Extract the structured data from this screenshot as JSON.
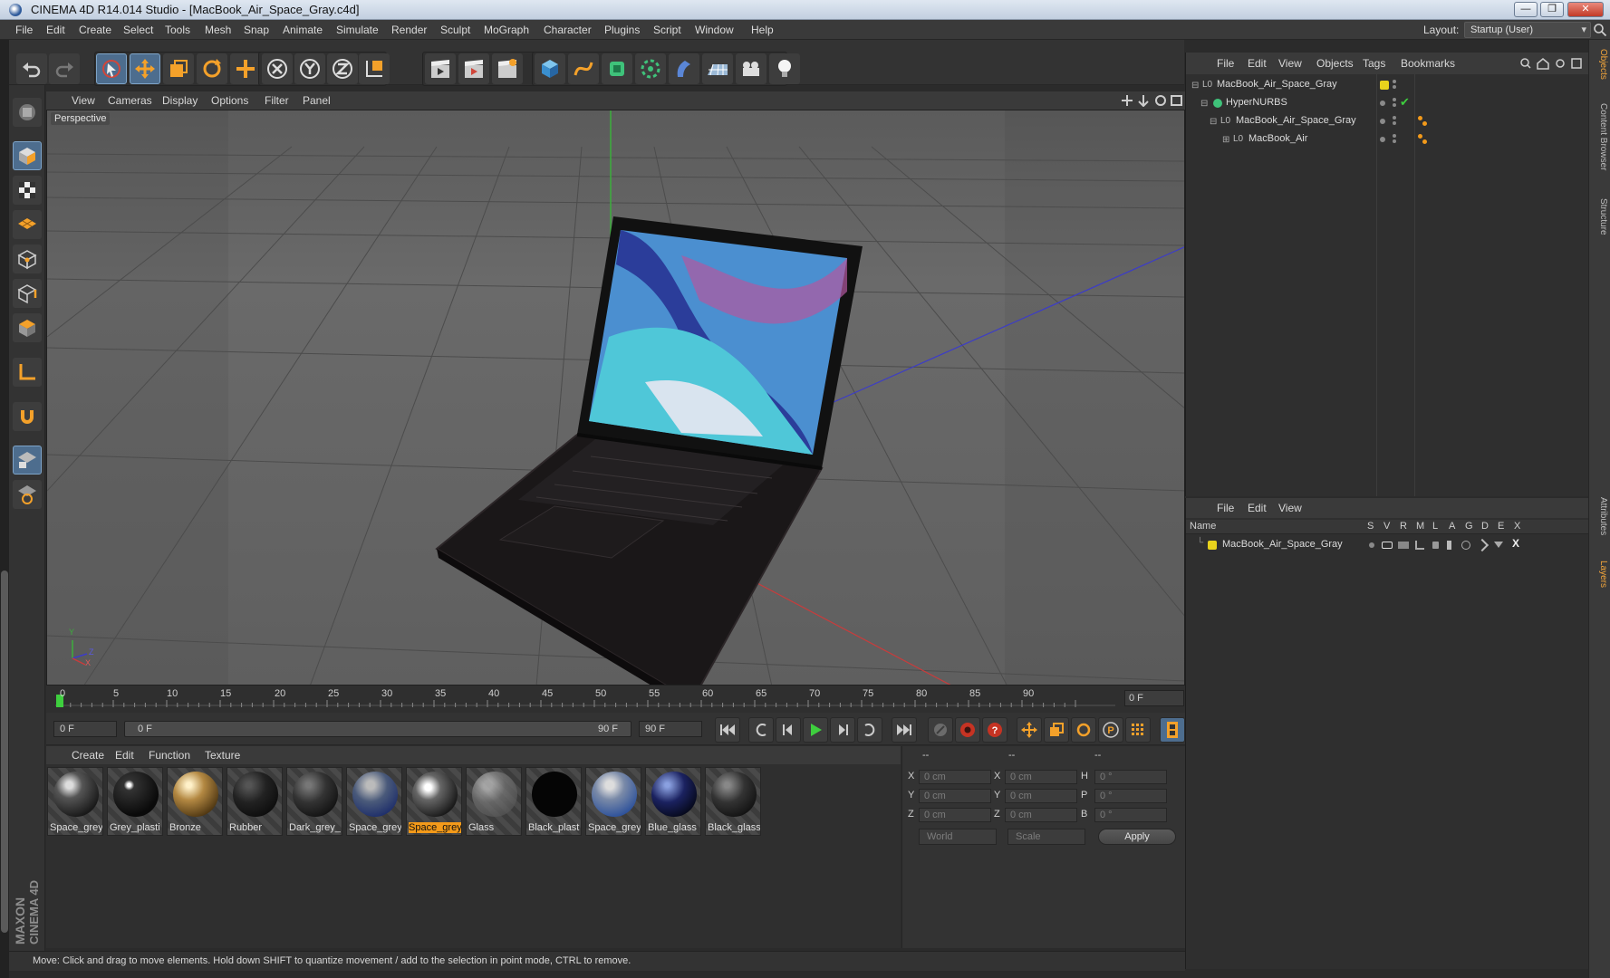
{
  "window": {
    "title": "CINEMA 4D R14.014 Studio - [MacBook_Air_Space_Gray.c4d]",
    "controls": [
      "—",
      "❐",
      "✕"
    ]
  },
  "menubar": {
    "items": [
      "File",
      "Edit",
      "Create",
      "Select",
      "Tools",
      "Mesh",
      "Snap",
      "Animate",
      "Simulate",
      "Render",
      "Sculpt",
      "MoGraph",
      "Character",
      "Plugins",
      "Script",
      "Window",
      "Help"
    ],
    "layout_label": "Layout:",
    "layout_value": "Startup (User)"
  },
  "viewport": {
    "menu": [
      "View",
      "Cameras",
      "Display",
      "Options",
      "Filter",
      "Panel"
    ],
    "label": "Perspective",
    "axis_labels": {
      "y": "Y",
      "z": "Z",
      "x": "X"
    }
  },
  "timeline": {
    "ticks": [
      "0",
      "5",
      "10",
      "15",
      "20",
      "25",
      "30",
      "35",
      "40",
      "45",
      "50",
      "55",
      "60",
      "65",
      "70",
      "75",
      "80",
      "85",
      "90"
    ],
    "current_frame": "0 F"
  },
  "transport": {
    "start_field": "0 F",
    "range_start": "0 F",
    "range_end": "90 F",
    "end_field": "90 F"
  },
  "materials": {
    "menu": [
      "Create",
      "Edit",
      "Function",
      "Texture"
    ],
    "items": [
      {
        "label": "Space_grey",
        "selected": false
      },
      {
        "label": "Grey_plasti",
        "selected": false
      },
      {
        "label": "Bronze",
        "selected": false
      },
      {
        "label": "Rubber",
        "selected": false
      },
      {
        "label": "Dark_grey_",
        "selected": false
      },
      {
        "label": "Space_grey",
        "selected": false
      },
      {
        "label": "Space_grey",
        "selected": true
      },
      {
        "label": "Glass",
        "selected": false
      },
      {
        "label": "Black_plast",
        "selected": false
      },
      {
        "label": "Space_grey",
        "selected": false
      },
      {
        "label": "Blue_glass",
        "selected": false
      },
      {
        "label": "Black_glass",
        "selected": false
      }
    ]
  },
  "coordinates": {
    "headers": [
      "--",
      "--",
      "--"
    ],
    "rows": [
      {
        "pos_label": "X",
        "pos": "0 cm",
        "size_label": "X",
        "size": "0 cm",
        "rot_label": "H",
        "rot": "0 °"
      },
      {
        "pos_label": "Y",
        "pos": "0 cm",
        "size_label": "Y",
        "size": "0 cm",
        "rot_label": "P",
        "rot": "0 °"
      },
      {
        "pos_label": "Z",
        "pos": "0 cm",
        "size_label": "Z",
        "size": "0 cm",
        "rot_label": "B",
        "rot": "0 °"
      }
    ],
    "mode_world": "World",
    "mode_scale": "Scale",
    "apply": "Apply"
  },
  "status": {
    "text": "Move: Click and drag to move elements. Hold down SHIFT to quantize movement / add to the selection in point mode, CTRL to remove."
  },
  "object_manager": {
    "menu": [
      "File",
      "Edit",
      "View",
      "Objects",
      "Tags",
      "Bookmarks"
    ],
    "rows": [
      {
        "name": "MacBook_Air_Space_Gray",
        "level": 0
      },
      {
        "name": "HyperNURBS",
        "level": 1
      },
      {
        "name": "MacBook_Air_Space_Gray",
        "level": 2
      },
      {
        "name": "MacBook_Air",
        "level": 3
      }
    ]
  },
  "layers": {
    "menu": [
      "File",
      "Edit",
      "View"
    ],
    "columns": [
      "Name",
      "S",
      "V",
      "R",
      "M",
      "L",
      "A",
      "G",
      "D",
      "E",
      "X"
    ],
    "rows": [
      {
        "name": "MacBook_Air_Space_Gray",
        "color": "#e8d21c"
      }
    ]
  },
  "right_tabs": [
    "Objects",
    "Content Browser",
    "Structure",
    "Attributes",
    "Layers"
  ],
  "brand": {
    "line1": "MAXON",
    "line2": "CINEMA 4D"
  },
  "colors": {
    "accent_orange": "#f39a1a",
    "active_blue": "#4d6d8e",
    "layer_yellow": "#e8d21c",
    "play_green": "#3ecf3e"
  }
}
